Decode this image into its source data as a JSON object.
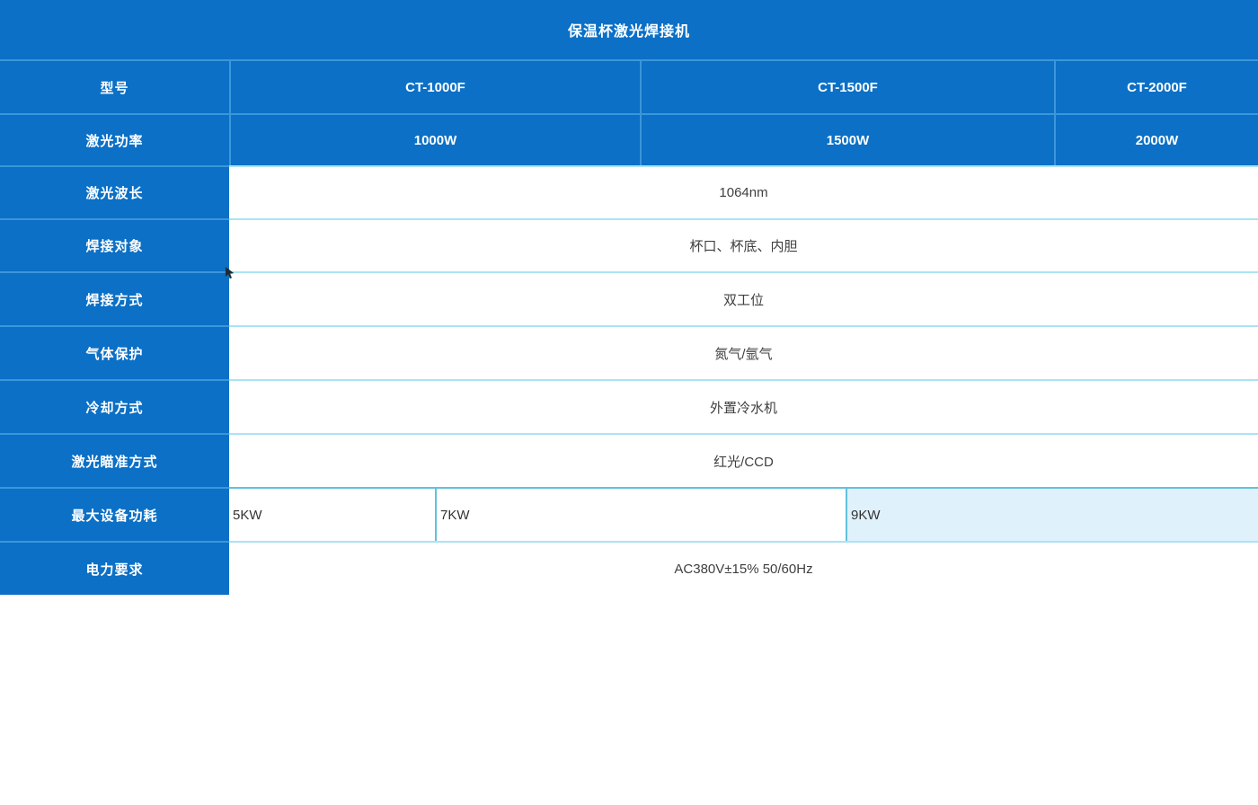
{
  "colors": {
    "primary_blue": "#0b70c6",
    "blue_divider": "#3c96da",
    "pale_cyan_divider": "#abe3f4",
    "teal_divider": "#62c1dd",
    "highlight_cell_bg": "#dff1fb",
    "header_text": "#ffffff",
    "value_text": "#3f3f3f"
  },
  "table": {
    "title": "保温杯激光焊接机",
    "rows": {
      "model": {
        "label": "型号",
        "values": [
          "CT-1000F",
          "CT-1500F",
          "CT-2000F"
        ]
      },
      "laser_power": {
        "label": "激光功率",
        "values": [
          "1000W",
          "1500W",
          "2000W"
        ]
      },
      "specs": [
        {
          "label": "激光波长",
          "value": "1064nm"
        },
        {
          "label": "焊接对象",
          "value": "杯口、杯底、内胆"
        },
        {
          "label": "焊接方式",
          "value": "双工位"
        },
        {
          "label": "气体保护",
          "value": "氮气/氩气"
        },
        {
          "label": "冷却方式",
          "value": "外置冷水机"
        },
        {
          "label": "激光瞄准方式",
          "value": "红光/CCD"
        }
      ],
      "max_power_consumption": {
        "label": "最大设备功耗",
        "values": [
          "5KW",
          "7KW",
          "9KW"
        ]
      },
      "power_requirement": {
        "label": "电力要求",
        "value": "AC380V±15% 50/60Hz"
      }
    }
  }
}
